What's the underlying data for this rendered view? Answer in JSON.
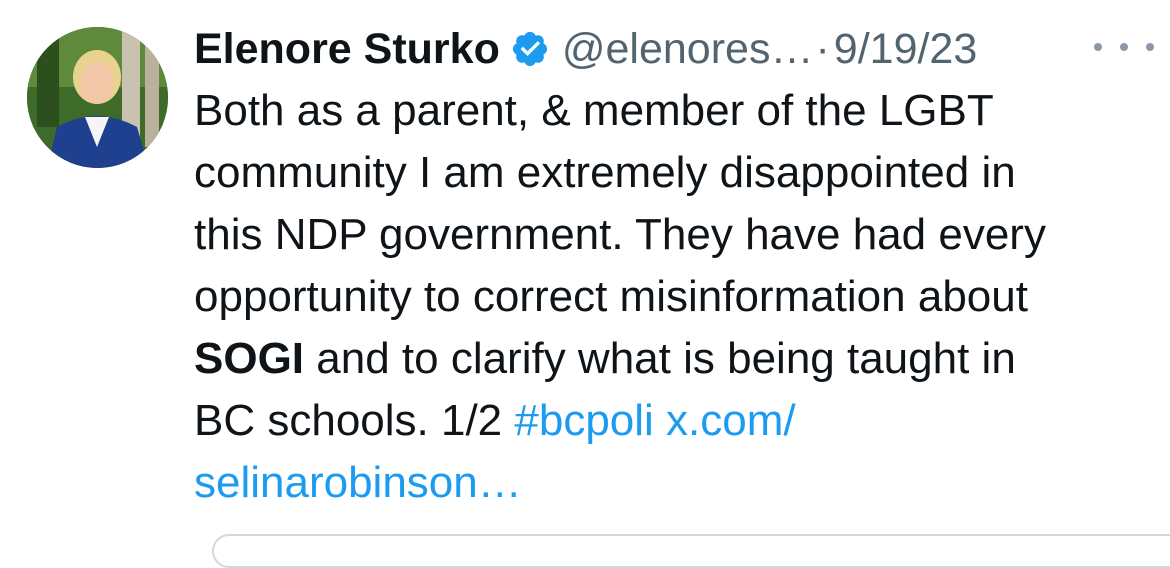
{
  "tweet": {
    "author_name": "Elenore Sturko",
    "handle": "@elenores…",
    "separator": "·",
    "date": "9/19/23",
    "verified": true,
    "more_icon": "more-horizontal-icon",
    "text_lines": {
      "l1": "Both as a parent, & member of the LGBT",
      "l2": "community I am extremely disappointed in",
      "l3": "this NDP government. They have had every",
      "l4": "opportunity to correct misinformation about",
      "l5_bold": "SOGI",
      "l5_rest": " and to clarify what is being taught in",
      "l6_plain": "BC schools. 1/2 ",
      "hashtag": "#bcpoli",
      "link_start": " x.com/",
      "link_end": "selinarobinson…"
    },
    "colors": {
      "text": "#0f1419",
      "secondary": "#536471",
      "link": "#1d9bf0",
      "verified": "#1d9bf0"
    }
  }
}
